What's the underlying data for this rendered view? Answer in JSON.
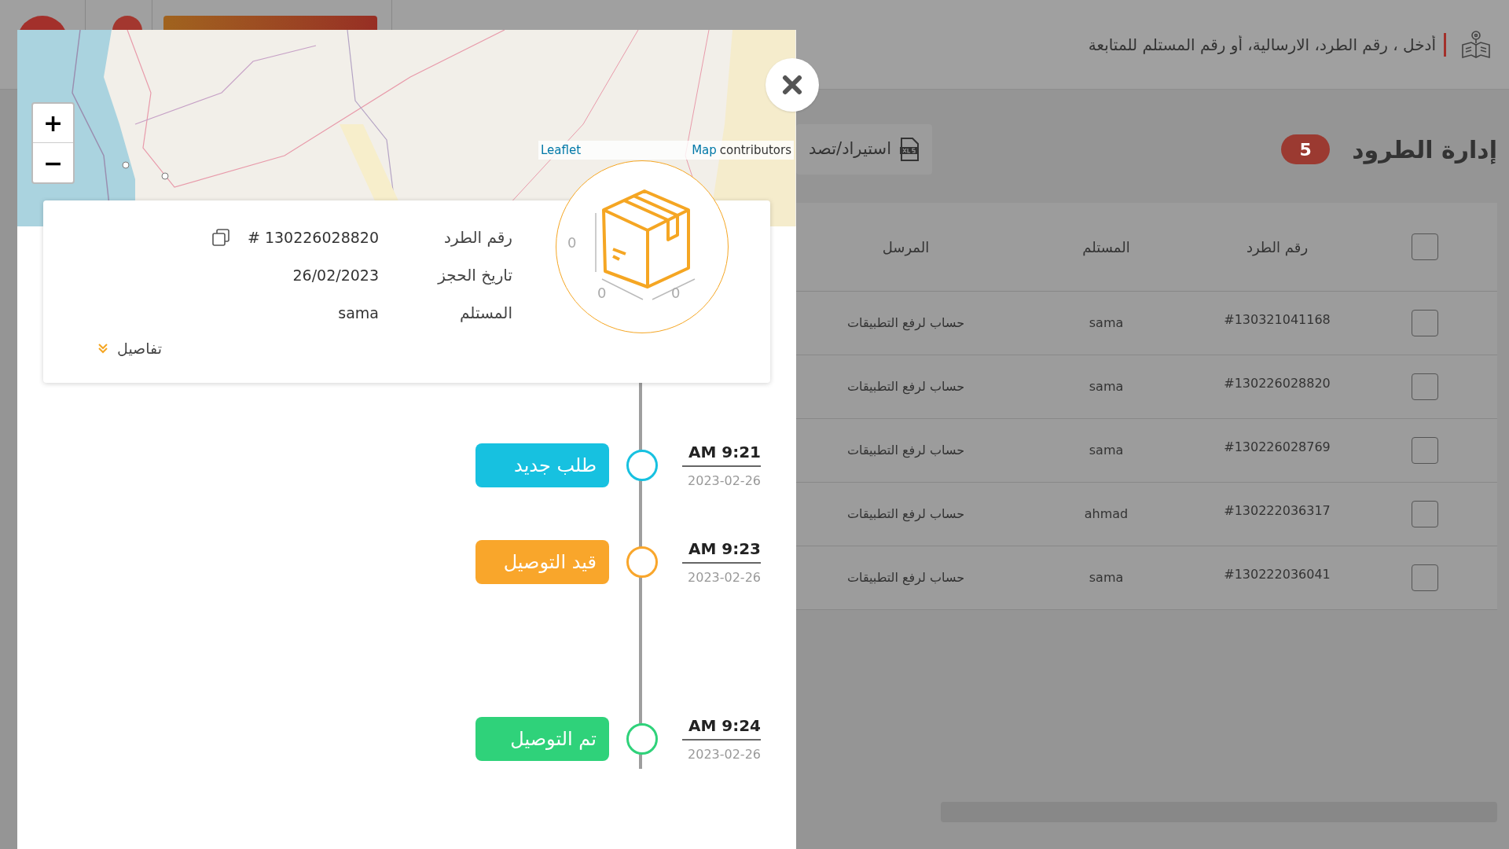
{
  "header": {
    "search": {
      "placeholder": "أدخل ، رقم الطرد، الارسالية، أو رقم المستلم للمتابعة"
    }
  },
  "page": {
    "title": "إدارة الطرود",
    "count": "5",
    "export_button": "استيراد/تصد"
  },
  "table": {
    "select_all": {
      "checked": false
    },
    "columns": [
      "رقم الطرد",
      "المستلم",
      "المرسل"
    ],
    "rows": [
      {
        "checked": false,
        "number": "#130321041168",
        "recipient": "sama",
        "sender": "حساب لرفع التطبيقات"
      },
      {
        "checked": false,
        "number": "#130226028820",
        "recipient": "sama",
        "sender": "حساب لرفع التطبيقات"
      },
      {
        "checked": false,
        "number": "#130226028769",
        "recipient": "sama",
        "sender": "حساب لرفع التطبيقات"
      },
      {
        "checked": false,
        "number": "#130222036317",
        "recipient": "ahmad",
        "sender": "حساب لرفع التطبيقات"
      },
      {
        "checked": false,
        "number": "#130222036041",
        "recipient": "sama",
        "sender": "حساب لرفع التطبيقات"
      }
    ]
  },
  "drawer": {
    "map": {
      "zoom_in": "+",
      "zoom_out": "−",
      "attribution": {
        "leaflet_link": "Leaflet",
        "map_link": "Map",
        "suffix": "contributors"
      }
    },
    "package_counts": [
      "0",
      "0",
      "0"
    ],
    "details": {
      "fields": [
        {
          "label": "رقم الطرد",
          "value": "# 130226028820",
          "copy_button": true
        },
        {
          "label": "تاريخ الحجز",
          "value": "26/02/2023",
          "copy_button": false
        },
        {
          "label": "المستلم",
          "value": "sama",
          "copy_button": false
        }
      ],
      "more_link": "تفاصيل"
    },
    "timeline": [
      {
        "status": "طلب جديد",
        "color": "#17c1e0",
        "time": "AM 9:21",
        "date": "2023-02-26"
      },
      {
        "status": "قيد التوصيل",
        "color": "#f9a62b",
        "time": "AM 9:23",
        "date": "2023-02-26"
      },
      {
        "status": "تم التوصيل",
        "color": "#2fd27a",
        "time": "AM 9:24",
        "date": "2023-02-26"
      }
    ]
  }
}
